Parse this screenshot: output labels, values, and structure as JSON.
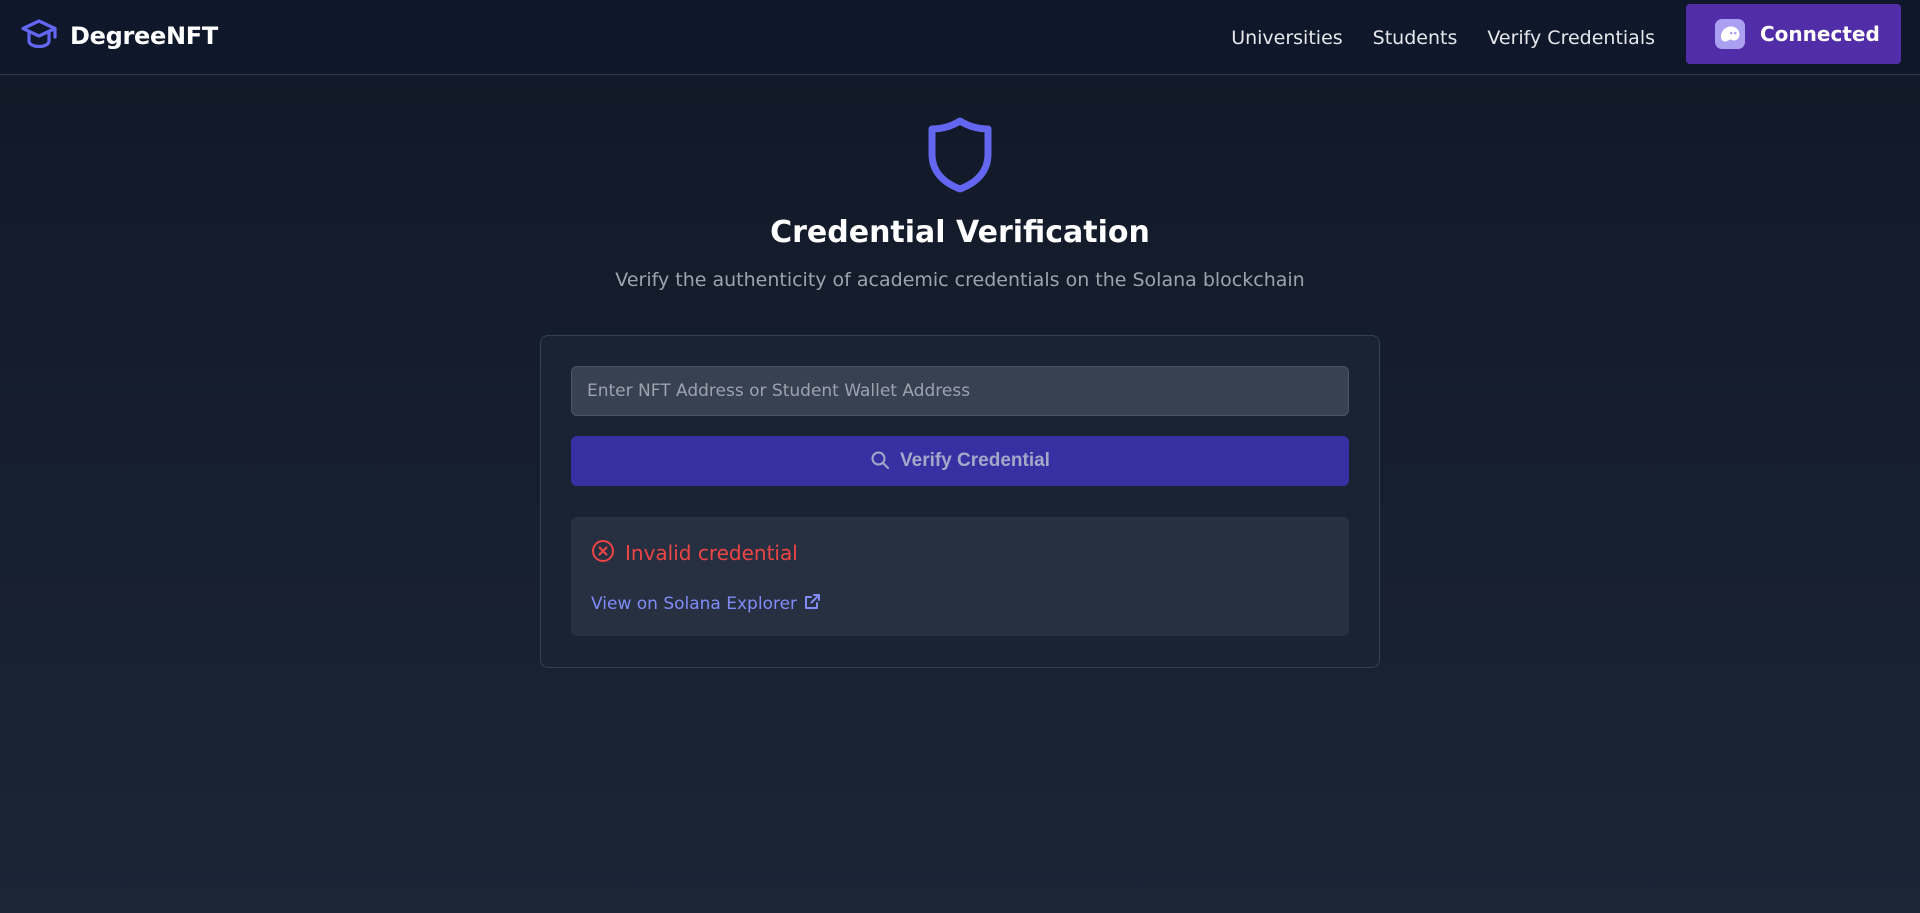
{
  "brand": {
    "name": "DegreeNFT",
    "icon": "graduation-cap-icon",
    "color": "#6366f1"
  },
  "nav": {
    "links": [
      "Universities",
      "Students",
      "Verify Credentials"
    ],
    "wallet_button": {
      "label": "Connected",
      "icon": "phantom-wallet-icon",
      "color": "#512da8"
    }
  },
  "hero": {
    "icon": "shield-icon",
    "title": "Credential Verification",
    "subtitle": "Verify the authenticity of academic credentials on the Solana blockchain"
  },
  "form": {
    "input_placeholder": "Enter NFT Address or Student Wallet Address",
    "input_value": "",
    "verify_button_label": "Verify Credential",
    "verify_button_icon": "search-icon"
  },
  "result": {
    "status_icon": "x-circle-icon",
    "status_text": "Invalid credential",
    "status_color": "#ef4444",
    "explorer_link_text": "View on Solana Explorer",
    "explorer_link_icon": "external-link-icon"
  }
}
